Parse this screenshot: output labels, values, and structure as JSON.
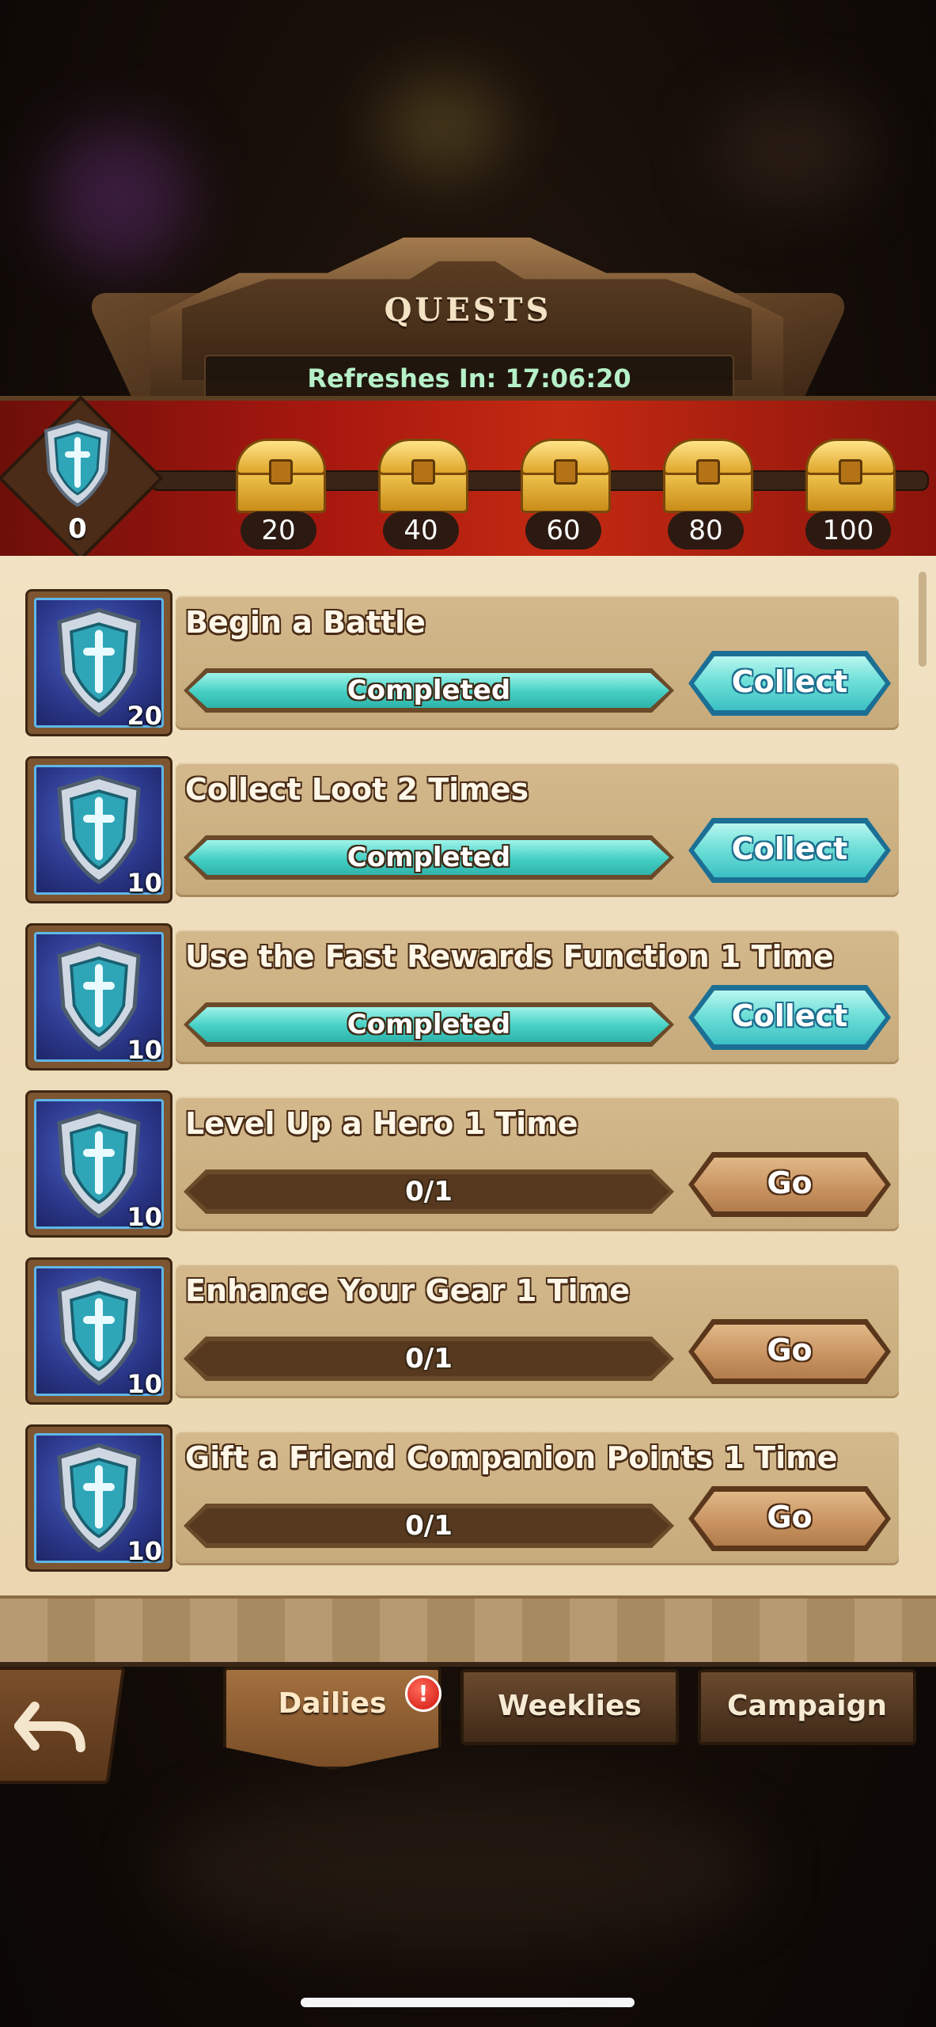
{
  "header": {
    "title": "Quests",
    "refresh_label": "Refreshes In:",
    "refresh_time": "17:06:20"
  },
  "milestones": {
    "current_points": "0",
    "chests": [
      "20",
      "40",
      "60",
      "80",
      "100"
    ]
  },
  "quests": [
    {
      "title": "Begin a Battle",
      "points": "20",
      "progress_text": "Completed",
      "progress_fraction": 1,
      "button": "Collect",
      "state": "collect"
    },
    {
      "title": "Collect Loot 2 Times",
      "points": "10",
      "progress_text": "Completed",
      "progress_fraction": 1,
      "button": "Collect",
      "state": "collect"
    },
    {
      "title": "Use the Fast Rewards Function 1 Time",
      "points": "10",
      "progress_text": "Completed",
      "progress_fraction": 1,
      "button": "Collect",
      "state": "collect"
    },
    {
      "title": "Level Up a Hero 1 Time",
      "points": "10",
      "progress_text": "0/1",
      "progress_fraction": 0,
      "button": "Go",
      "state": "go"
    },
    {
      "title": "Enhance Your Gear 1 Time",
      "points": "10",
      "progress_text": "0/1",
      "progress_fraction": 0,
      "button": "Go",
      "state": "go"
    },
    {
      "title": "Gift a Friend Companion Points 1 Time",
      "points": "10",
      "progress_text": "0/1",
      "progress_fraction": 0,
      "button": "Go",
      "state": "go"
    }
  ],
  "tabs": {
    "dailies": "Dailies",
    "weeklies": "Weeklies",
    "campaign": "Campaign",
    "dailies_badge": "!"
  },
  "icons": {
    "milestone_emblem": "shield-sword-icon",
    "chest": "treasure-chest-icon",
    "back": "back-arrow-icon"
  },
  "colors": {
    "collect_button": "#6fe0d8",
    "go_button": "#c99462",
    "progress_complete": "#45cfc4",
    "band_red": "#c42a12"
  }
}
